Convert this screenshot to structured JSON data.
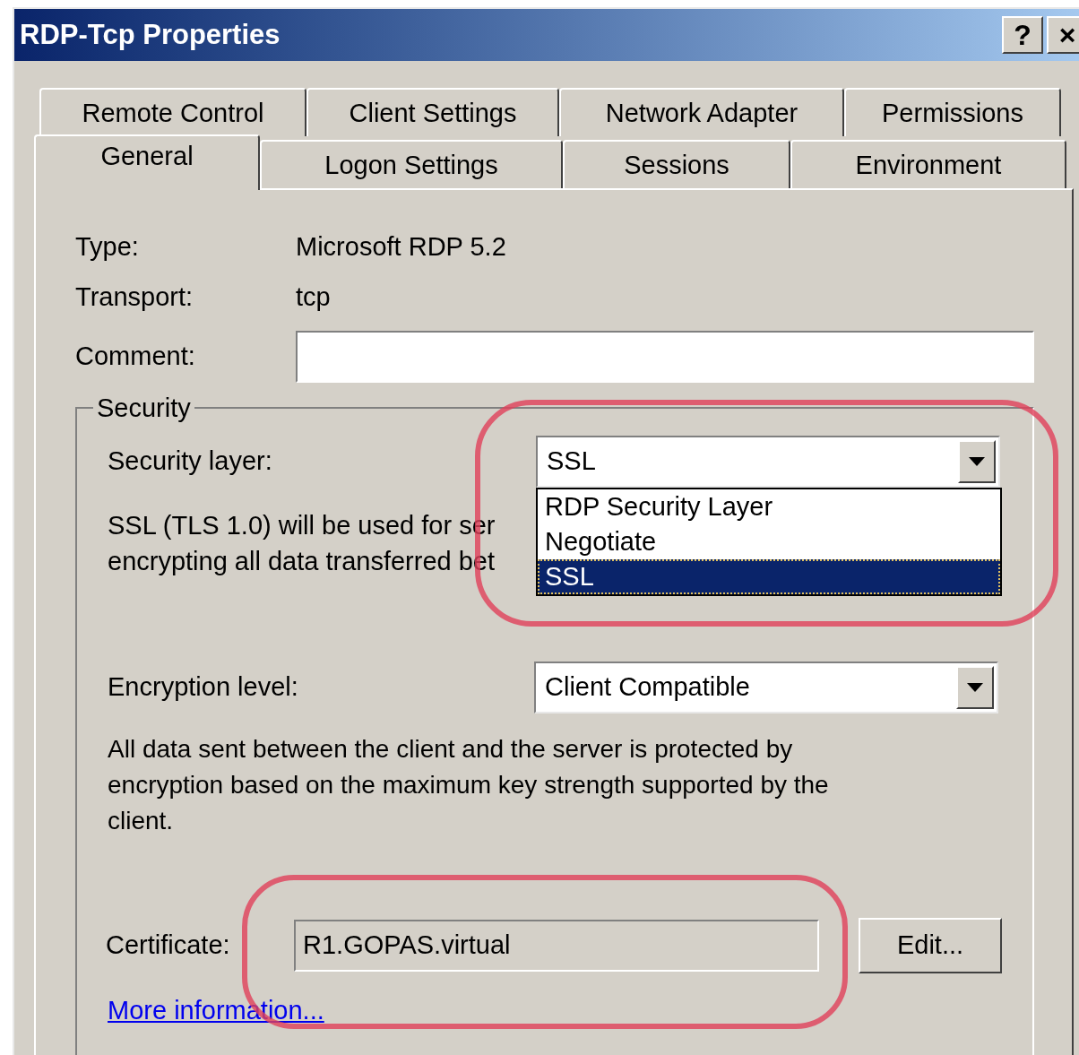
{
  "window": {
    "title": "RDP-Tcp Properties",
    "buttons": [
      "?",
      "×"
    ]
  },
  "tab_rows": [
    {
      "tabs": [
        {
          "label": "Remote Control",
          "selected": false
        },
        {
          "label": "Client Settings",
          "selected": false
        },
        {
          "label": "Network Adapter",
          "selected": false
        },
        {
          "label": "Permissions",
          "selected": false
        }
      ]
    },
    {
      "tabs": [
        {
          "label": "General",
          "selected": true
        },
        {
          "label": "Logon Settings",
          "selected": false
        },
        {
          "label": "Sessions",
          "selected": false
        },
        {
          "label": "Environment",
          "selected": false
        }
      ]
    }
  ],
  "info": [
    {
      "label": "Type:",
      "value": "Microsoft RDP 5.2"
    },
    {
      "label": "Transport:",
      "value": "tcp"
    }
  ],
  "comment": {
    "label": "Comment:"
  },
  "security": {
    "title": "Security",
    "security_layer": {
      "label": "Security layer:",
      "value": "SSL",
      "expanded": true,
      "options": [
        {
          "label": "RDP Security Layer",
          "selected": false
        },
        {
          "label": "Negotiate",
          "selected": false
        },
        {
          "label": "SSL",
          "selected": true
        }
      ]
    },
    "security_layer_description": [
      "SSL (TLS 1.0) will be used for ser",
      "encrypting all data transferred bet"
    ],
    "encryption_level": {
      "label": "Encryption level:",
      "value": "Client Compatible"
    },
    "encryption_description": "All data sent between the client and the server is protected by encryption based on the maximum key strength supported by the client.",
    "certificate": {
      "label": "Certificate:",
      "value": "R1.GOPAS.virtual",
      "button": "Edit..."
    },
    "link": "More information..."
  }
}
